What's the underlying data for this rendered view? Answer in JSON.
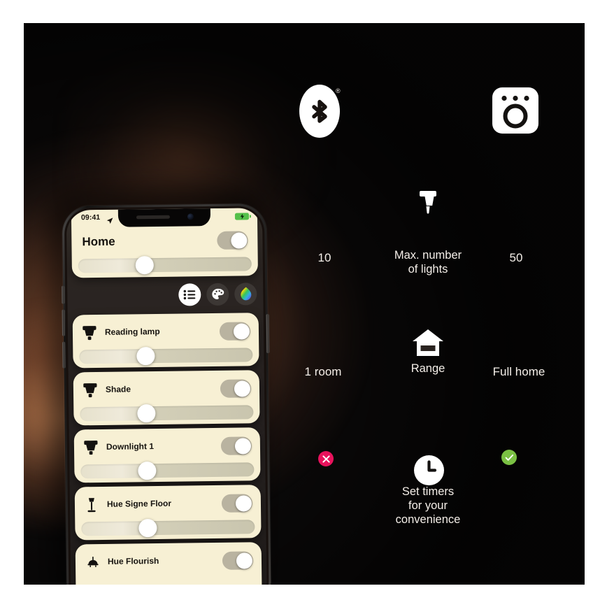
{
  "canvas": {
    "background_dark": "#0c0a0a",
    "glow_color": "#c47848"
  },
  "phone": {
    "status_bar": {
      "time": "09:41",
      "location_icon": "location-arrow-icon",
      "battery_icon": "battery-charging-icon",
      "battery_color": "#54c04a"
    },
    "header": {
      "title": "Home",
      "toggle": {
        "name": "home-master-toggle",
        "state": "on"
      },
      "brightness_slider": {
        "name": "home-brightness-slider",
        "value": 38
      }
    },
    "mode_buttons": [
      {
        "name": "list-view-button",
        "icon": "list-icon",
        "active": true
      },
      {
        "name": "scenes-palette-button",
        "icon": "palette-icon",
        "active": false
      },
      {
        "name": "color-picker-button",
        "icon": "color-droplet-icon",
        "active": false
      }
    ],
    "lights": [
      {
        "name": "Reading lamp",
        "icon": "bulb-spot-icon",
        "toggle": "on",
        "brightness": 38
      },
      {
        "name": "Shade",
        "icon": "bulb-spot-icon",
        "toggle": "on",
        "brightness": 38
      },
      {
        "name": "Downlight 1",
        "icon": "bulb-spot-icon",
        "toggle": "on",
        "brightness": 38
      },
      {
        "name": "Hue Signe Floor",
        "icon": "floor-lamp-icon",
        "toggle": "on",
        "brightness": 38
      },
      {
        "name": "Hue Flourish",
        "icon": "pendant-lamp-icon",
        "toggle": "on",
        "brightness": 38
      }
    ]
  },
  "comparison": {
    "top_icons": {
      "left": {
        "name": "bluetooth-icon",
        "trademark": "®"
      },
      "right": {
        "name": "hue-bridge-icon"
      }
    },
    "rows": [
      {
        "id": "max-lights",
        "icon": "light-bulb-icon",
        "label": "Max. number\nof lights",
        "label_line1": "Max. number",
        "label_line2": "of lights",
        "left_value": "10",
        "right_value": "50"
      },
      {
        "id": "range",
        "icon": "house-icon",
        "label": "Range",
        "left_value": "1 room",
        "right_value": "Full home"
      },
      {
        "id": "timers",
        "icon": "clock-icon",
        "label_line1": "Set timers",
        "label_line2": "for your",
        "label_line3": "convenience",
        "left_value": "x-badge",
        "right_value": "check-badge",
        "left_badge_color": "#e8125c",
        "right_badge_color": "#7ac043"
      }
    ]
  }
}
